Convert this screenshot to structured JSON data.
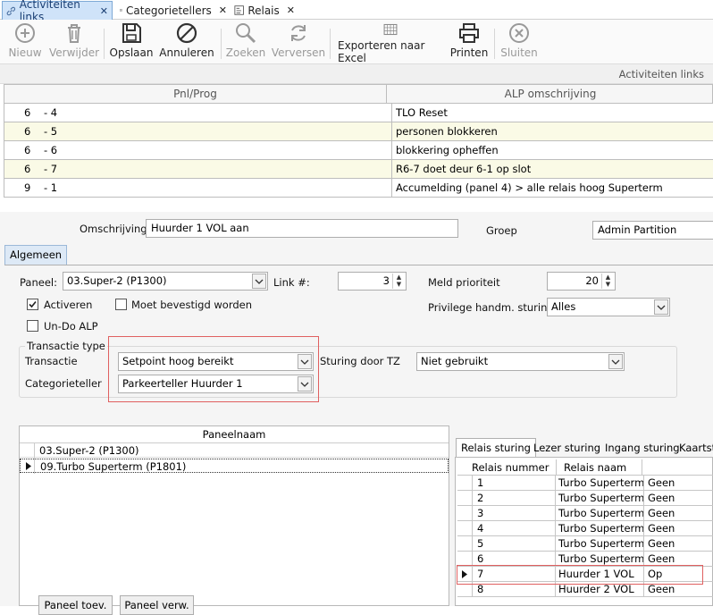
{
  "tabs": [
    {
      "label": "Activiteiten links",
      "icon": "link-icon"
    },
    {
      "label": "Categorietellers",
      "icon": "table-icon"
    },
    {
      "label": "Relais",
      "icon": "relais-icon"
    }
  ],
  "toolbar": {
    "nieuw": "Nieuw",
    "verwijder": "Verwijder",
    "opslaan": "Opslaan",
    "annuleren": "Annuleren",
    "zoeken": "Zoeken",
    "verversen": "Verversen",
    "exporteren": "Exporteren naar Excel",
    "printen": "Printen",
    "sluiten": "Sluiten"
  },
  "grid": {
    "title": "Activiteiten links",
    "col1": "Pnl/Prog",
    "col2": "ALP omschrijving",
    "rows": [
      {
        "pnl": "6",
        "prog": "- 4",
        "desc": "TLO Reset"
      },
      {
        "pnl": "6",
        "prog": "- 5",
        "desc": "personen blokkeren"
      },
      {
        "pnl": "6",
        "prog": "- 6",
        "desc": "blokkering opheffen"
      },
      {
        "pnl": "6",
        "prog": "- 7",
        "desc": "R6-7 doet deur 6-1 op slot"
      },
      {
        "pnl": "9",
        "prog": "- 1",
        "desc": "Accumelding (panel 4) > alle relais hoog Superterm"
      }
    ]
  },
  "detail": {
    "omschrijving_label": "Omschrijving",
    "omschrijving_value": "Huurder 1 VOL aan",
    "groep_label": "Groep",
    "groep_value": "Admin Partition",
    "tab_algemeen": "Algemeen",
    "paneel_label": "Paneel:",
    "paneel_value": "03.Super-2 (P1300)",
    "link_label": "Link #:",
    "link_value": "3",
    "meld_label": "Meld prioriteit",
    "meld_value": "20",
    "activeren": "Activeren",
    "moet_bevestigd": "Moet bevestigd worden",
    "privilege_label": "Privilege handm. sturing:",
    "privilege_value": "Alles",
    "undo_alp": "Un-Do ALP",
    "transactie_type": "Transactie type",
    "transactie_label": "Transactie",
    "transactie_value": "Setpoint hoog bereikt",
    "sturing_tz_label": "Sturing door TZ",
    "sturing_tz_value": "Niet gebruikt",
    "categorieteller_label": "Categorieteller",
    "categorieteller_value": "Parkeerteller Huurder 1"
  },
  "panelen": {
    "header": "Paneelnaam",
    "rows": [
      "03.Super-2 (P1300)",
      "09.Turbo Superterm (P1801)"
    ],
    "btn_toev": "Paneel toev.",
    "btn_verw": "Paneel verw."
  },
  "relais": {
    "tabs": [
      "Relais sturing",
      "Lezer sturing",
      "Ingang sturing",
      "Kaartstu"
    ],
    "col_nummer": "Relais nummer",
    "col_naam": "Relais naam",
    "rows": [
      {
        "nr": "1",
        "naam": "Turbo Superterm",
        "status": "Geen"
      },
      {
        "nr": "2",
        "naam": "Turbo Superterm",
        "status": "Geen"
      },
      {
        "nr": "3",
        "naam": "Turbo Superterm",
        "status": "Geen"
      },
      {
        "nr": "4",
        "naam": "Turbo Superterm",
        "status": "Geen"
      },
      {
        "nr": "5",
        "naam": "Turbo Superterm",
        "status": "Geen"
      },
      {
        "nr": "6",
        "naam": "Turbo Superterm",
        "status": "Geen"
      },
      {
        "nr": "7",
        "naam": "Huurder 1 VOL",
        "status": "Op"
      },
      {
        "nr": "8",
        "naam": "Huurder 2 VOL",
        "status": "Geen"
      }
    ]
  },
  "colors": {
    "accent": "#cfe3f9",
    "highlight": "#e06060",
    "alt_row": "#fafae6"
  }
}
